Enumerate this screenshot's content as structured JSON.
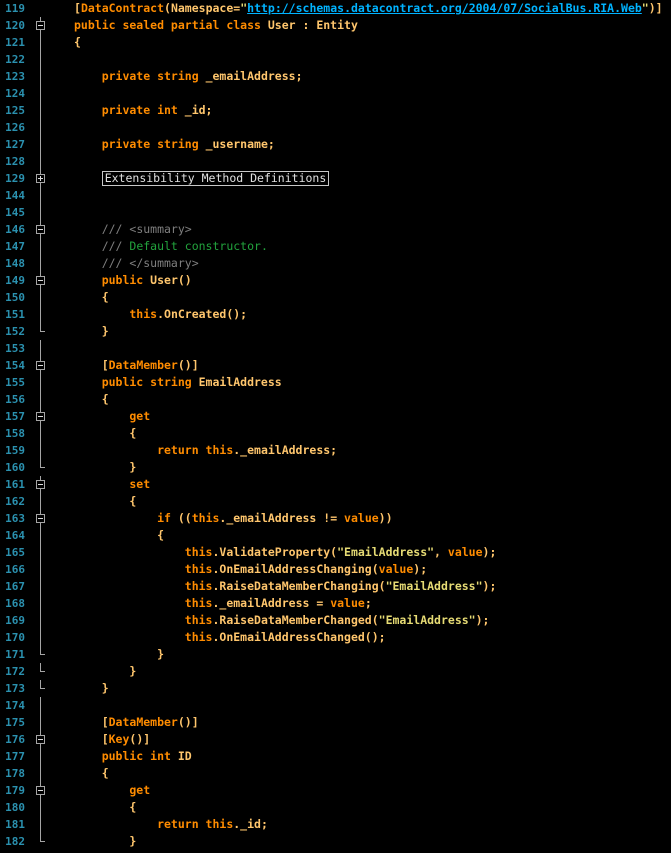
{
  "editor": {
    "line_numbers": [
      "119",
      "120",
      "121",
      "122",
      "123",
      "124",
      "125",
      "126",
      "127",
      "128",
      "129",
      "144",
      "145",
      "146",
      "147",
      "148",
      "149",
      "150",
      "151",
      "152",
      "153",
      "154",
      "155",
      "156",
      "157",
      "158",
      "159",
      "160",
      "161",
      "162",
      "163",
      "164",
      "165",
      "166",
      "167",
      "168",
      "169",
      "170",
      "171",
      "172",
      "173",
      "174",
      "175",
      "176",
      "177",
      "178",
      "179",
      "180",
      "181",
      "182"
    ],
    "lines": [
      [
        {
          "t": "[",
          "c": "txt"
        },
        {
          "t": "DataContract",
          "c": "kw"
        },
        {
          "t": "(Namespace=",
          "c": "txt"
        },
        {
          "t": "\"",
          "c": "str"
        },
        {
          "t": "http://schemas.datacontract.org/2004/07/SocialBus.RIA.Web",
          "c": "link"
        },
        {
          "t": "\"",
          "c": "str"
        },
        {
          "t": ")]",
          "c": "txt"
        }
      ],
      [
        {
          "t": "public sealed partial class ",
          "c": "kw"
        },
        {
          "t": "User : Entity",
          "c": "txt"
        }
      ],
      [
        {
          "t": "{",
          "c": "txt"
        }
      ],
      [],
      [
        {
          "t": "    private string ",
          "c": "kw"
        },
        {
          "t": "_emailAddress;",
          "c": "txt"
        }
      ],
      [],
      [
        {
          "t": "    private int ",
          "c": "kw"
        },
        {
          "t": "_id;",
          "c": "txt"
        }
      ],
      [],
      [
        {
          "t": "    private string ",
          "c": "kw"
        },
        {
          "t": "_username;",
          "c": "txt"
        }
      ],
      [],
      [
        {
          "t": "    ",
          "c": "txt"
        },
        {
          "t": "Extensibility Method Definitions",
          "c": "region"
        }
      ],
      [],
      [],
      [
        {
          "t": "    /// ",
          "c": "cmg"
        },
        {
          "t": "<summary>",
          "c": "cmg"
        }
      ],
      [
        {
          "t": "    /// ",
          "c": "cmg"
        },
        {
          "t": "Default constructor.",
          "c": "cm"
        }
      ],
      [
        {
          "t": "    /// ",
          "c": "cmg"
        },
        {
          "t": "</summary>",
          "c": "cmg"
        }
      ],
      [
        {
          "t": "    public ",
          "c": "kw"
        },
        {
          "t": "User()",
          "c": "txt"
        }
      ],
      [
        {
          "t": "    {",
          "c": "txt"
        }
      ],
      [
        {
          "t": "        this",
          "c": "kw"
        },
        {
          "t": ".OnCreated();",
          "c": "txt"
        }
      ],
      [
        {
          "t": "    }",
          "c": "txt"
        }
      ],
      [],
      [
        {
          "t": "    [",
          "c": "txt"
        },
        {
          "t": "DataMember",
          "c": "kw"
        },
        {
          "t": "()]",
          "c": "txt"
        }
      ],
      [
        {
          "t": "    public string ",
          "c": "kw"
        },
        {
          "t": "EmailAddress",
          "c": "txt"
        }
      ],
      [
        {
          "t": "    {",
          "c": "txt"
        }
      ],
      [
        {
          "t": "        get",
          "c": "kw"
        }
      ],
      [
        {
          "t": "        {",
          "c": "txt"
        }
      ],
      [
        {
          "t": "            return this",
          "c": "kw"
        },
        {
          "t": "._emailAddress;",
          "c": "txt"
        }
      ],
      [
        {
          "t": "        }",
          "c": "txt"
        }
      ],
      [
        {
          "t": "        set",
          "c": "kw"
        }
      ],
      [
        {
          "t": "        {",
          "c": "txt"
        }
      ],
      [
        {
          "t": "            if ",
          "c": "kw"
        },
        {
          "t": "((",
          "c": "txt"
        },
        {
          "t": "this",
          "c": "kw"
        },
        {
          "t": "._emailAddress != ",
          "c": "txt"
        },
        {
          "t": "value",
          "c": "kw"
        },
        {
          "t": "))",
          "c": "txt"
        }
      ],
      [
        {
          "t": "            {",
          "c": "txt"
        }
      ],
      [
        {
          "t": "                this",
          "c": "kw"
        },
        {
          "t": ".ValidateProperty(",
          "c": "txt"
        },
        {
          "t": "\"EmailAddress\"",
          "c": "str"
        },
        {
          "t": ", ",
          "c": "txt"
        },
        {
          "t": "value",
          "c": "kw"
        },
        {
          "t": ");",
          "c": "txt"
        }
      ],
      [
        {
          "t": "                this",
          "c": "kw"
        },
        {
          "t": ".OnEmailAddressChanging(",
          "c": "txt"
        },
        {
          "t": "value",
          "c": "kw"
        },
        {
          "t": ");",
          "c": "txt"
        }
      ],
      [
        {
          "t": "                this",
          "c": "kw"
        },
        {
          "t": ".RaiseDataMemberChanging(",
          "c": "txt"
        },
        {
          "t": "\"EmailAddress\"",
          "c": "str"
        },
        {
          "t": ");",
          "c": "txt"
        }
      ],
      [
        {
          "t": "                this",
          "c": "kw"
        },
        {
          "t": "._emailAddress = ",
          "c": "txt"
        },
        {
          "t": "value",
          "c": "kw"
        },
        {
          "t": ";",
          "c": "txt"
        }
      ],
      [
        {
          "t": "                this",
          "c": "kw"
        },
        {
          "t": ".RaiseDataMemberChanged(",
          "c": "txt"
        },
        {
          "t": "\"EmailAddress\"",
          "c": "str"
        },
        {
          "t": ");",
          "c": "txt"
        }
      ],
      [
        {
          "t": "                this",
          "c": "kw"
        },
        {
          "t": ".OnEmailAddressChanged();",
          "c": "txt"
        }
      ],
      [
        {
          "t": "            }",
          "c": "txt"
        }
      ],
      [
        {
          "t": "        }",
          "c": "txt"
        }
      ],
      [
        {
          "t": "    }",
          "c": "txt"
        }
      ],
      [],
      [
        {
          "t": "    [",
          "c": "txt"
        },
        {
          "t": "DataMember",
          "c": "kw"
        },
        {
          "t": "()]",
          "c": "txt"
        }
      ],
      [
        {
          "t": "    [",
          "c": "txt"
        },
        {
          "t": "Key",
          "c": "kw"
        },
        {
          "t": "()]",
          "c": "txt"
        }
      ],
      [
        {
          "t": "    public int ",
          "c": "kw"
        },
        {
          "t": "ID",
          "c": "txt"
        }
      ],
      [
        {
          "t": "    {",
          "c": "txt"
        }
      ],
      [
        {
          "t": "        get",
          "c": "kw"
        }
      ],
      [
        {
          "t": "        {",
          "c": "txt"
        }
      ],
      [
        {
          "t": "            return this",
          "c": "kw"
        },
        {
          "t": "._id;",
          "c": "txt"
        }
      ],
      [
        {
          "t": "        }",
          "c": "txt"
        }
      ]
    ],
    "outline": [
      "",
      "box",
      "line",
      "line",
      "line",
      "line",
      "line",
      "line",
      "line",
      "line",
      "plus",
      "line",
      "line",
      "box",
      "line",
      "line",
      "box",
      "line",
      "line",
      "end",
      "line",
      "box",
      "line",
      "line",
      "box",
      "line",
      "line",
      "end",
      "box",
      "line",
      "box",
      "line",
      "line",
      "line",
      "line",
      "line",
      "line",
      "line",
      "end",
      "end",
      "end",
      "line",
      "line",
      "box",
      "line",
      "line",
      "box",
      "line",
      "line",
      "end"
    ]
  }
}
